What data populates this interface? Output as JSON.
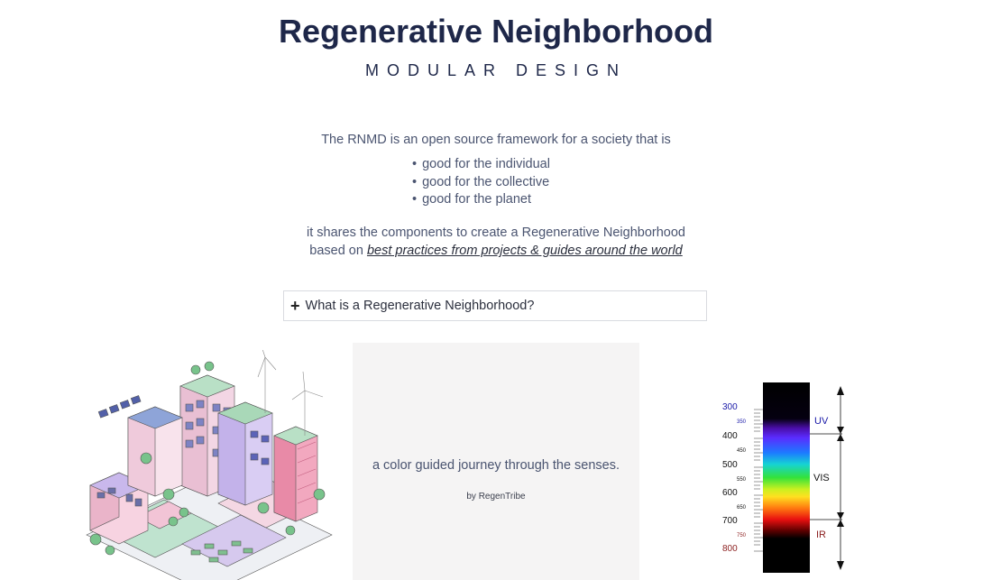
{
  "header": {
    "title": "Regenerative Neighborhood",
    "subtitle": "MODULAR DESIGN"
  },
  "intro": {
    "text": "The RNMD is an open source framework for a society that is",
    "bullets": [
      "good for the individual",
      "good for the collective",
      "good for the planet"
    ]
  },
  "shares": {
    "line1": "it shares the components to create a Regenerative Neighborhood",
    "line2_prefix": "based on",
    "link_label": "best practices from projects & guides around the world"
  },
  "accordion": {
    "icon": "plus-icon",
    "question": "What is a Regenerative Neighborhood?"
  },
  "panel": {
    "tagline": "a color guided journey through the senses.",
    "byline": "by RegenTribe"
  },
  "spectrum": {
    "major_ticks": [
      "300",
      "400",
      "500",
      "600",
      "700",
      "800"
    ],
    "minor_ticks": [
      "350",
      "450",
      "550",
      "650",
      "750"
    ],
    "bands": [
      "UV",
      "VIS",
      "IR"
    ],
    "colors": {
      "uv": "#1a1aa8",
      "ir": "#8b1e1e",
      "vis": "#111111"
    }
  },
  "colors": {
    "title": "#1e2749",
    "text": "#4a5470",
    "panel_bg": "#f5f4f4"
  }
}
